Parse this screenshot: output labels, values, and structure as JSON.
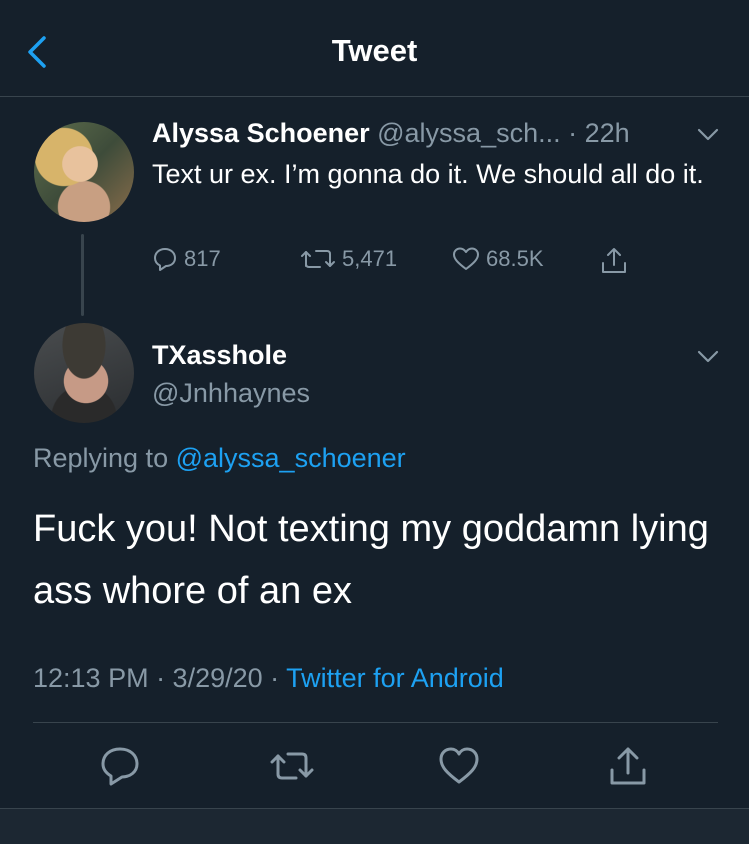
{
  "header": {
    "title": "Tweet",
    "back_icon": "chevron-left-icon"
  },
  "colors": {
    "background": "#15202b",
    "accent": "#1da1f2",
    "muted": "#8899a6",
    "divider": "#38444d"
  },
  "original_tweet": {
    "name": "Alyssa Schoener",
    "handle": "@alyssa_sch...",
    "time": "· 22h",
    "text": "Text ur ex. I’m gonna do it. We should all do it.",
    "replies": "817",
    "retweets": "5,471",
    "likes": "68.5K"
  },
  "reply_tweet": {
    "name": "TXasshole",
    "handle": "@Jnhhaynes",
    "replying_prefix": "Replying to",
    "replying_to": "@alyssa_schoener",
    "text": "Fuck you! Not texting my goddamn lying ass whore of an ex",
    "timestamp": "12:13 PM · 3/29/20 ·",
    "source": "Twitter for Android"
  }
}
